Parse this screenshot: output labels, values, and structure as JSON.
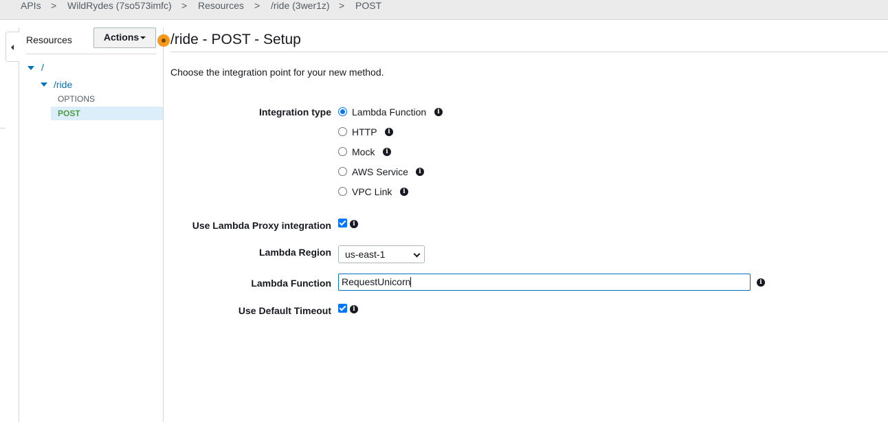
{
  "breadcrumb": {
    "items": [
      "APIs",
      "WildRydes (7so573imfc)",
      "Resources",
      "/ride (3wer1z)",
      "POST"
    ],
    "separator": ">"
  },
  "resources_panel": {
    "title": "Resources",
    "actions_label": "Actions",
    "tree": {
      "root": "/",
      "child": "/ride",
      "methods": [
        "OPTIONS",
        "POST"
      ],
      "selected_method": "POST"
    }
  },
  "main": {
    "title": "/ride - POST - Setup",
    "intro": "Choose the integration point for your new method.",
    "integration_type": {
      "label": "Integration type",
      "options": [
        "Lambda Function",
        "HTTP",
        "Mock",
        "AWS Service",
        "VPC Link"
      ],
      "selected": "Lambda Function"
    },
    "proxy": {
      "label": "Use Lambda Proxy integration",
      "checked": true
    },
    "region": {
      "label": "Lambda Region",
      "value": "us-east-1"
    },
    "function": {
      "label": "Lambda Function",
      "value": "RequestUnicorn"
    },
    "timeout": {
      "label": "Use Default Timeout",
      "checked": true
    }
  },
  "colors": {
    "link_blue": "#0073bb",
    "selected_bg": "#dceefa",
    "post_green": "#1d8102",
    "control_blue": "#0075ff",
    "status_orange": "#f7991c"
  },
  "icons": {
    "info": "info-circle-icon",
    "collapse": "caret-left-icon",
    "tree_expand": "caret-down-icon"
  }
}
